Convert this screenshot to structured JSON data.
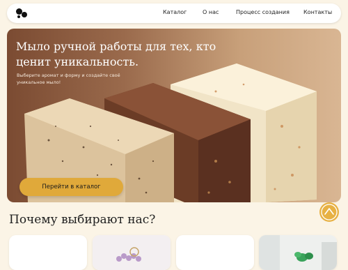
{
  "nav": {
    "logo_icon": "bubbles-logo-icon",
    "items": [
      "Каталог",
      "О нас",
      "Процесс создания",
      "Контакты"
    ]
  },
  "hero": {
    "title": "Мыло ручной работы для тех, кто ценит уникальность.",
    "subtitle": "Выберите аромат и форму и создайте своё уникальное мыло!",
    "cta_label": "Перейти в каталог"
  },
  "scroll_top_icon": "chevron-up-icon",
  "why_section": {
    "title": "Почему выбирают нас?",
    "cards": [
      "card-1",
      "card-2",
      "card-3",
      "card-4"
    ]
  },
  "colors": {
    "accent": "#e0a93a",
    "background": "#fbf4e6",
    "hero_brown": "#7b4b32"
  }
}
